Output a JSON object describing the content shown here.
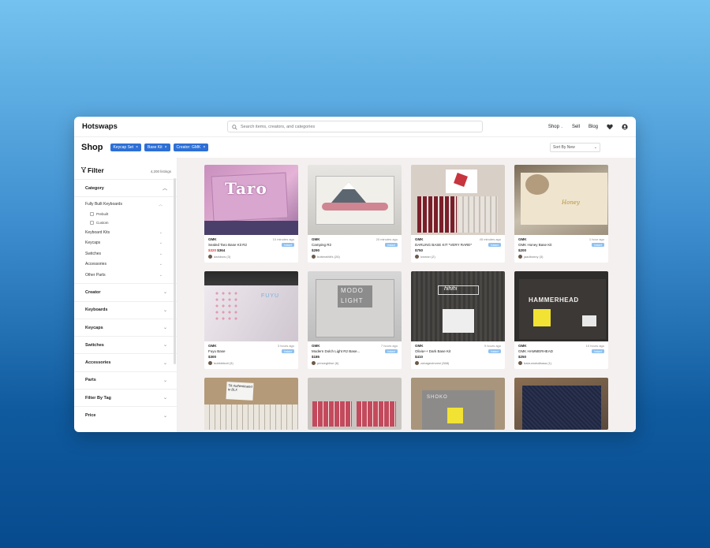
{
  "app": {
    "logo": "Hotswaps",
    "search_placeholder": "Search items, creators, and categories",
    "nav": {
      "shop": "Shop",
      "sell": "Sell",
      "blog": "Blog"
    }
  },
  "shop": {
    "title": "Shop",
    "chips": [
      "Keycap Set",
      "Base Kit",
      "Creator: GMK"
    ],
    "sort": "Sort By New"
  },
  "filter": {
    "title": "Filter",
    "count": "4,200 listings",
    "category_label": "Category",
    "sub_fully": "Fully Built Keyboards",
    "cb_prebuilt": "Prebuilt",
    "cb_custom": "Custom",
    "subs": [
      "Keyboard Kits",
      "Keycaps",
      "Switches",
      "Accessories",
      "Other Parts"
    ],
    "sections": [
      "Creator",
      "Keyboards",
      "Keycaps",
      "Switches",
      "Accessories",
      "Parts",
      "Filter By Tag",
      "Price"
    ]
  },
  "listings": [
    {
      "brand": "GMK",
      "time": "10 minutes ago",
      "title": "Sealed Taro Base Kit R2",
      "price_old": "$320",
      "price": "$364",
      "seller": "darkbow (3)",
      "badge": "Instant"
    },
    {
      "brand": "GMK",
      "time": "20 minutes ago",
      "title": "Camping R2",
      "price_old": "",
      "price": "$290",
      "seller": "butterathlt's (26)",
      "badge": "Instant"
    },
    {
      "brand": "GMK",
      "time": "45 minutes ago",
      "title": "DARLING BASE KIT *VERY RARE*",
      "price_old": "",
      "price": "$750",
      "seller": "icsman (2)",
      "badge": "Instant"
    },
    {
      "brand": "GMK",
      "time": "1 hour ago",
      "title": "GMK Honey Base Kit",
      "price_old": "",
      "price": "$200",
      "seller": "jaadbonny (3)",
      "badge": "Instant"
    },
    {
      "brand": "GMK",
      "time": "3 hours ago",
      "title": "Fuyu Base",
      "price_old": "",
      "price": "$300",
      "seller": "bubblebutt (3)",
      "badge": "Instant"
    },
    {
      "brand": "GMK",
      "time": "7 hours ago",
      "title": "Modern Dolch Light R2 Base...",
      "price_old": "",
      "price": "$185",
      "seller": "princeghlise (6)",
      "badge": "Instant"
    },
    {
      "brand": "GMK",
      "time": "9 hours ago",
      "title": "Olivia++ Dark Base Kit",
      "price_old": "",
      "price": "$410",
      "seller": "zubageoinvest (368)",
      "badge": "Instant"
    },
    {
      "brand": "GMK",
      "time": "10 hours ago",
      "title": "GMK HAMMERHEAD",
      "price_old": "",
      "price": "$250",
      "seller": "baizumobalbasa (1)",
      "badge": "Instant"
    }
  ],
  "image_text": {
    "taro": "Taro",
    "fuyu": "FUYU",
    "modo1": "MODO",
    "modo2": "LIGHT",
    "hihihi": "hihihi",
    "hammer": "HAMMERHEAD",
    "handwritten": "Tik Authenticated to BLX",
    "shoko": "SHOKO"
  },
  "colors": {
    "accent": "#2d6fd6",
    "badge": "#8fc1f0",
    "sale": "#e03b3b"
  }
}
